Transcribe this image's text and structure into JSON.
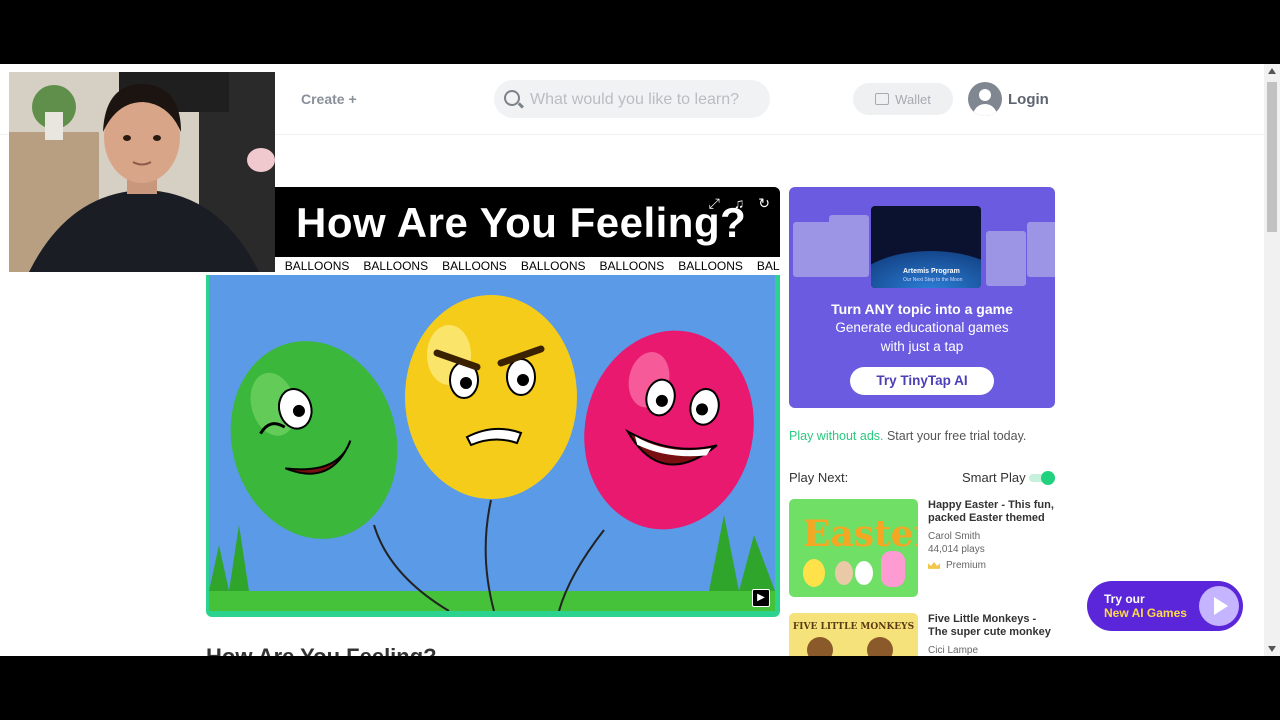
{
  "header": {
    "create_label": "Create +",
    "search_placeholder": "What would you like to learn?",
    "wallet_label": "Wallet",
    "login_label": "Login"
  },
  "game": {
    "title": "How Are You Feeling?",
    "ticker_word": "BALLOONS",
    "title_below": "How Are You Feeling?"
  },
  "promo": {
    "card_caption": "Artemis Program",
    "card_subcaption": "Our Next Step to the Moon",
    "headline": "Turn ANY topic into a game",
    "line1": "Generate educational games",
    "line2": "with just a tap",
    "button_label": "Try TinyTap AI"
  },
  "ads": {
    "link": "Play without ads.",
    "text": " Start your free trial today."
  },
  "play_next": {
    "label": "Play Next:",
    "smart_play_label": "Smart Play",
    "smart_play_on": true,
    "items": [
      {
        "title": "Happy Easter - This fun, packed Easter themed",
        "author": "Carol Smith",
        "plays": "44,014 plays",
        "badge": "Premium",
        "thumb_text": "Easter"
      },
      {
        "title": "Five Little Monkeys - The super cute monkey",
        "author": "Cici Lampe",
        "thumb_text": "FIVE LITTLE MONKEYS"
      }
    ]
  },
  "ai_games": {
    "line1": "Try our",
    "line2": "New AI Games"
  },
  "colors": {
    "brand_green": "#29c97f",
    "promo_purple": "#6a5be0",
    "ai_purple": "#5b26d9"
  }
}
